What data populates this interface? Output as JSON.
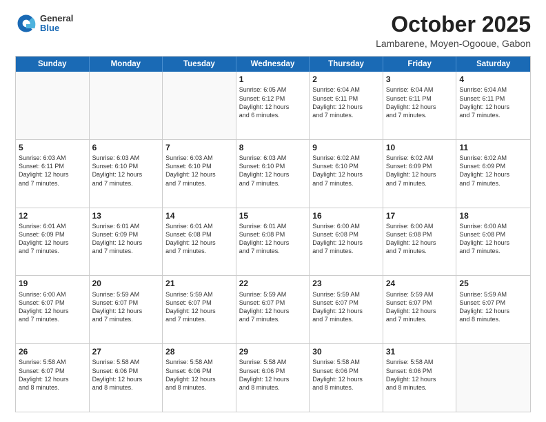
{
  "header": {
    "logo": {
      "general": "General",
      "blue": "Blue"
    },
    "title": "October 2025",
    "location": "Lambarene, Moyen-Ogooue, Gabon"
  },
  "days": [
    "Sunday",
    "Monday",
    "Tuesday",
    "Wednesday",
    "Thursday",
    "Friday",
    "Saturday"
  ],
  "weeks": [
    [
      {
        "day": "",
        "text": "",
        "empty": true
      },
      {
        "day": "",
        "text": "",
        "empty": true
      },
      {
        "day": "",
        "text": "",
        "empty": true
      },
      {
        "day": "1",
        "text": "Sunrise: 6:05 AM\nSunset: 6:12 PM\nDaylight: 12 hours\nand 6 minutes."
      },
      {
        "day": "2",
        "text": "Sunrise: 6:04 AM\nSunset: 6:11 PM\nDaylight: 12 hours\nand 7 minutes."
      },
      {
        "day": "3",
        "text": "Sunrise: 6:04 AM\nSunset: 6:11 PM\nDaylight: 12 hours\nand 7 minutes."
      },
      {
        "day": "4",
        "text": "Sunrise: 6:04 AM\nSunset: 6:11 PM\nDaylight: 12 hours\nand 7 minutes."
      }
    ],
    [
      {
        "day": "5",
        "text": "Sunrise: 6:03 AM\nSunset: 6:11 PM\nDaylight: 12 hours\nand 7 minutes."
      },
      {
        "day": "6",
        "text": "Sunrise: 6:03 AM\nSunset: 6:10 PM\nDaylight: 12 hours\nand 7 minutes."
      },
      {
        "day": "7",
        "text": "Sunrise: 6:03 AM\nSunset: 6:10 PM\nDaylight: 12 hours\nand 7 minutes."
      },
      {
        "day": "8",
        "text": "Sunrise: 6:03 AM\nSunset: 6:10 PM\nDaylight: 12 hours\nand 7 minutes."
      },
      {
        "day": "9",
        "text": "Sunrise: 6:02 AM\nSunset: 6:10 PM\nDaylight: 12 hours\nand 7 minutes."
      },
      {
        "day": "10",
        "text": "Sunrise: 6:02 AM\nSunset: 6:09 PM\nDaylight: 12 hours\nand 7 minutes."
      },
      {
        "day": "11",
        "text": "Sunrise: 6:02 AM\nSunset: 6:09 PM\nDaylight: 12 hours\nand 7 minutes."
      }
    ],
    [
      {
        "day": "12",
        "text": "Sunrise: 6:01 AM\nSunset: 6:09 PM\nDaylight: 12 hours\nand 7 minutes."
      },
      {
        "day": "13",
        "text": "Sunrise: 6:01 AM\nSunset: 6:09 PM\nDaylight: 12 hours\nand 7 minutes."
      },
      {
        "day": "14",
        "text": "Sunrise: 6:01 AM\nSunset: 6:08 PM\nDaylight: 12 hours\nand 7 minutes."
      },
      {
        "day": "15",
        "text": "Sunrise: 6:01 AM\nSunset: 6:08 PM\nDaylight: 12 hours\nand 7 minutes."
      },
      {
        "day": "16",
        "text": "Sunrise: 6:00 AM\nSunset: 6:08 PM\nDaylight: 12 hours\nand 7 minutes."
      },
      {
        "day": "17",
        "text": "Sunrise: 6:00 AM\nSunset: 6:08 PM\nDaylight: 12 hours\nand 7 minutes."
      },
      {
        "day": "18",
        "text": "Sunrise: 6:00 AM\nSunset: 6:08 PM\nDaylight: 12 hours\nand 7 minutes."
      }
    ],
    [
      {
        "day": "19",
        "text": "Sunrise: 6:00 AM\nSunset: 6:07 PM\nDaylight: 12 hours\nand 7 minutes."
      },
      {
        "day": "20",
        "text": "Sunrise: 5:59 AM\nSunset: 6:07 PM\nDaylight: 12 hours\nand 7 minutes."
      },
      {
        "day": "21",
        "text": "Sunrise: 5:59 AM\nSunset: 6:07 PM\nDaylight: 12 hours\nand 7 minutes."
      },
      {
        "day": "22",
        "text": "Sunrise: 5:59 AM\nSunset: 6:07 PM\nDaylight: 12 hours\nand 7 minutes."
      },
      {
        "day": "23",
        "text": "Sunrise: 5:59 AM\nSunset: 6:07 PM\nDaylight: 12 hours\nand 7 minutes."
      },
      {
        "day": "24",
        "text": "Sunrise: 5:59 AM\nSunset: 6:07 PM\nDaylight: 12 hours\nand 7 minutes."
      },
      {
        "day": "25",
        "text": "Sunrise: 5:59 AM\nSunset: 6:07 PM\nDaylight: 12 hours\nand 8 minutes."
      }
    ],
    [
      {
        "day": "26",
        "text": "Sunrise: 5:58 AM\nSunset: 6:07 PM\nDaylight: 12 hours\nand 8 minutes."
      },
      {
        "day": "27",
        "text": "Sunrise: 5:58 AM\nSunset: 6:06 PM\nDaylight: 12 hours\nand 8 minutes."
      },
      {
        "day": "28",
        "text": "Sunrise: 5:58 AM\nSunset: 6:06 PM\nDaylight: 12 hours\nand 8 minutes."
      },
      {
        "day": "29",
        "text": "Sunrise: 5:58 AM\nSunset: 6:06 PM\nDaylight: 12 hours\nand 8 minutes."
      },
      {
        "day": "30",
        "text": "Sunrise: 5:58 AM\nSunset: 6:06 PM\nDaylight: 12 hours\nand 8 minutes."
      },
      {
        "day": "31",
        "text": "Sunrise: 5:58 AM\nSunset: 6:06 PM\nDaylight: 12 hours\nand 8 minutes."
      },
      {
        "day": "",
        "text": "",
        "empty": true
      }
    ]
  ]
}
